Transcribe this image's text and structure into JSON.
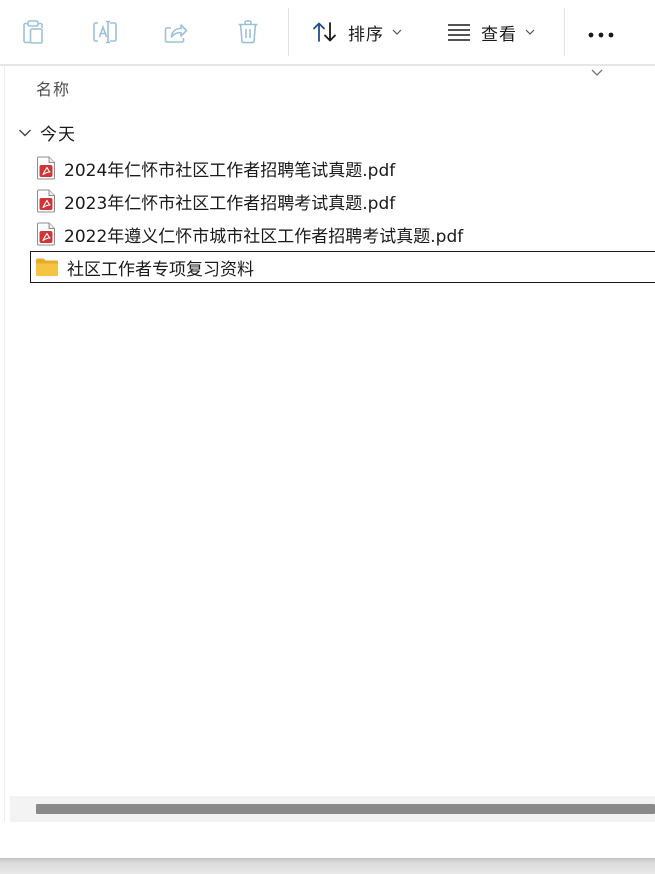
{
  "toolbar": {
    "buttons": [
      {
        "name": "copy",
        "icon": "copy-icon",
        "enabled": false
      },
      {
        "name": "rename",
        "icon": "rename-icon",
        "enabled": false
      },
      {
        "name": "share",
        "icon": "share-icon",
        "enabled": false
      },
      {
        "name": "delete",
        "icon": "trash-icon",
        "enabled": false
      }
    ],
    "sort_label": "排序",
    "view_label": "查看",
    "more_icon": "more-icon"
  },
  "list": {
    "column_header": "名称",
    "group_label": "今天",
    "items": [
      {
        "name": "2024年仁怀市社区工作者招聘笔试真题.pdf",
        "type": "pdf",
        "icon": "pdf-file-icon"
      },
      {
        "name": "2023年仁怀市社区工作者招聘考试真题.pdf",
        "type": "pdf",
        "icon": "pdf-file-icon"
      },
      {
        "name": "2022年遵义仁怀市城市社区工作者招聘考试真题.pdf",
        "type": "pdf",
        "icon": "pdf-file-icon"
      },
      {
        "name": "社区工作者专项复习资料",
        "type": "folder",
        "icon": "folder-icon",
        "selected": true
      }
    ]
  },
  "colors": {
    "disabled_icon": "#9cc0da",
    "pdf_red": "#d13438",
    "folder_yellow": "#f5c542",
    "scroll_thumb": "#8a8a8a"
  }
}
